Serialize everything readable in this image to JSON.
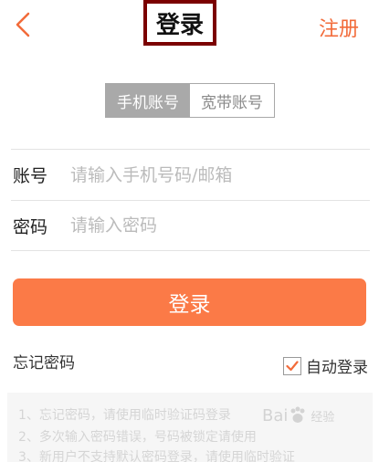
{
  "header": {
    "title": "登录",
    "register": "注册",
    "back_icon": "chevron-left-icon"
  },
  "tabs": [
    {
      "label": "手机账号",
      "active": true
    },
    {
      "label": "宽带账号",
      "active": false
    }
  ],
  "form": {
    "account_label": "账号",
    "account_placeholder": "请输入手机号码/邮箱",
    "password_label": "密码",
    "password_placeholder": "请输入密码"
  },
  "login_button": "登录",
  "forgot_password": "忘记密码",
  "auto_login": {
    "label": "自动登录",
    "checked": true
  },
  "notes": [
    "1、忘记密码，请使用临时验证码登录",
    "2、多次输入密码错误，号码被锁定请使用",
    "3、新用户不支持默认密码登录，请使用临时验证"
  ],
  "watermark": {
    "text": "Bai",
    "suffix": "经验"
  },
  "colors": {
    "accent": "#fb7a47",
    "register_text": "#f26b3a",
    "tab_active_bg": "#a9a9a9",
    "title_border": "#7b0000"
  }
}
